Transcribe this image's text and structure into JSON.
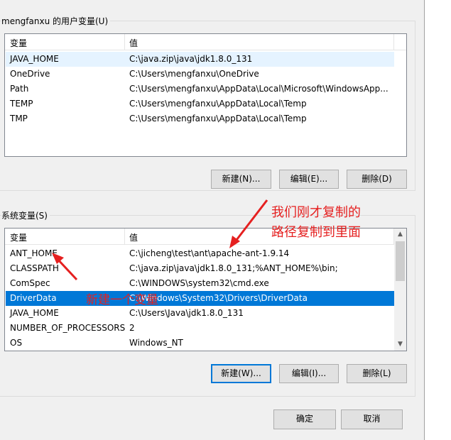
{
  "user_vars": {
    "group_label": "mengfanxu 的用户变量(U)",
    "headers": [
      "变量",
      "值"
    ],
    "rows": [
      {
        "name": "JAVA_HOME",
        "value": "C:\\java.zip\\java\\jdk1.8.0_131"
      },
      {
        "name": "OneDrive",
        "value": "C:\\Users\\mengfanxu\\OneDrive"
      },
      {
        "name": "Path",
        "value": "C:\\Users\\mengfanxu\\AppData\\Local\\Microsoft\\WindowsApp..."
      },
      {
        "name": "TEMP",
        "value": "C:\\Users\\mengfanxu\\AppData\\Local\\Temp"
      },
      {
        "name": "TMP",
        "value": "C:\\Users\\mengfanxu\\AppData\\Local\\Temp"
      }
    ],
    "buttons": {
      "new": "新建(N)...",
      "edit": "编辑(E)...",
      "delete": "删除(D)"
    }
  },
  "system_vars": {
    "group_label": "系统变量(S)",
    "headers": [
      "变量",
      "值"
    ],
    "rows": [
      {
        "name": "ANT_HOME",
        "value": "C:\\jicheng\\test\\ant\\apache-ant-1.9.14"
      },
      {
        "name": "CLASSPATH",
        "value": "C:\\java.zip\\java\\jdk1.8.0_131;%ANT_HOME%\\bin;"
      },
      {
        "name": "ComSpec",
        "value": "C:\\WINDOWS\\system32\\cmd.exe"
      },
      {
        "name": "DriverData",
        "value": "C:\\Windows\\System32\\Drivers\\DriverData"
      },
      {
        "name": "JAVA_HOME",
        "value": "C:\\Users\\Java\\jdk1.8.0_131"
      },
      {
        "name": "NUMBER_OF_PROCESSORS",
        "value": "2"
      },
      {
        "name": "OS",
        "value": "Windows_NT"
      }
    ],
    "buttons": {
      "new": "新建(W)...",
      "edit": "编辑(I)...",
      "delete": "删除(L)"
    }
  },
  "dialog_buttons": {
    "ok": "确定",
    "cancel": "取消"
  },
  "annotations": {
    "copy_path_line1": "我们刚才复制的",
    "copy_path_line2": "路径复制到里面",
    "new_variable": "新建一个变量"
  },
  "colors": {
    "annotation": "#e52020",
    "selection": "#0078d7",
    "hover": "#e5f3ff"
  }
}
